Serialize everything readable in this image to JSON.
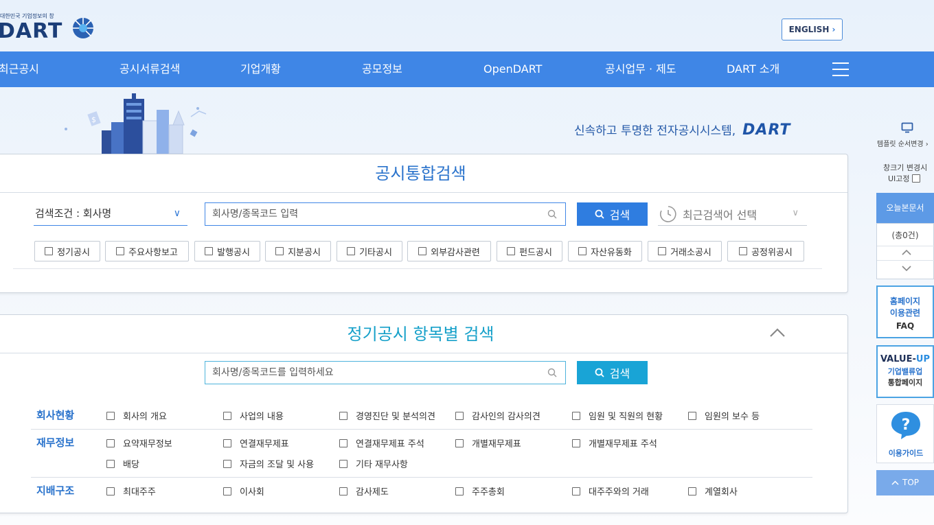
{
  "header": {
    "logo_sub": "대한민국 기업정보의 창",
    "logo_main": "DART",
    "lang_label": "ENGLISH"
  },
  "nav": {
    "items": [
      "최근공시",
      "공시서류검색",
      "기업개황",
      "공모정보",
      "OpenDART",
      "공시업무 · 제도",
      "DART 소개"
    ]
  },
  "banner": {
    "slogan": "신속하고 투명한 전자공시시스템,",
    "slogan_brand": "DART"
  },
  "integrated_search": {
    "title": "공시통합검색",
    "condition": "검색조건 : 회사명",
    "input_placeholder": "회사명/종목코드 입력",
    "search_label": "검색",
    "recent_label": "최근검색어 선택",
    "filters": [
      "정기공시",
      "주요사항보고",
      "발행공시",
      "지분공시",
      "기타공시",
      "외부감사관련",
      "펀드공시",
      "자산유동화",
      "거래소공시",
      "공정위공시"
    ]
  },
  "regular_search": {
    "title": "정기공시 항목별 검색",
    "input_placeholder": "회사명/종목코드를 입력하세요",
    "search_label": "검색",
    "categories": [
      {
        "name": "회사현황",
        "options": [
          "회사의 개요",
          "사업의 내용",
          "경영진단 및 분석의견",
          "감사인의 감사의견",
          "임원 및 직원의 현황",
          "임원의 보수 등"
        ]
      },
      {
        "name": "재무정보",
        "options": [
          "요약재무정보",
          "연결재무제표",
          "연결재무제표 주석",
          "개별재무제표",
          "개별재무제표 주석",
          "배당",
          "자금의 조달 및 사용",
          "기타 재무사항"
        ]
      },
      {
        "name": "지배구조",
        "options": [
          "최대주주",
          "이사회",
          "감사제도",
          "주주총회",
          "대주주와의 거래",
          "계열회사"
        ]
      }
    ]
  },
  "quick_menu": {
    "template_label": "템플릿 순서변경 ›",
    "resize_label_1": "창크기 변경시",
    "resize_label_2": "UI고정",
    "today_docs": "오늘본문서",
    "today_count": "(총0건)",
    "faq_line1": "홈페이지",
    "faq_line2": "이용관련",
    "faq_line3": "FAQ",
    "valueup_a": "VALUE-",
    "valueup_b": "UP",
    "valueup_line2": "기업밸류업",
    "valueup_line3": "통합페이지",
    "guide": "이용가이드",
    "top": "TOP"
  },
  "colors": {
    "nav_bg": "#3f86e6",
    "accent": "#2f7de0",
    "title_blue": "#2a73cc",
    "title_teal": "#15a0c9"
  }
}
